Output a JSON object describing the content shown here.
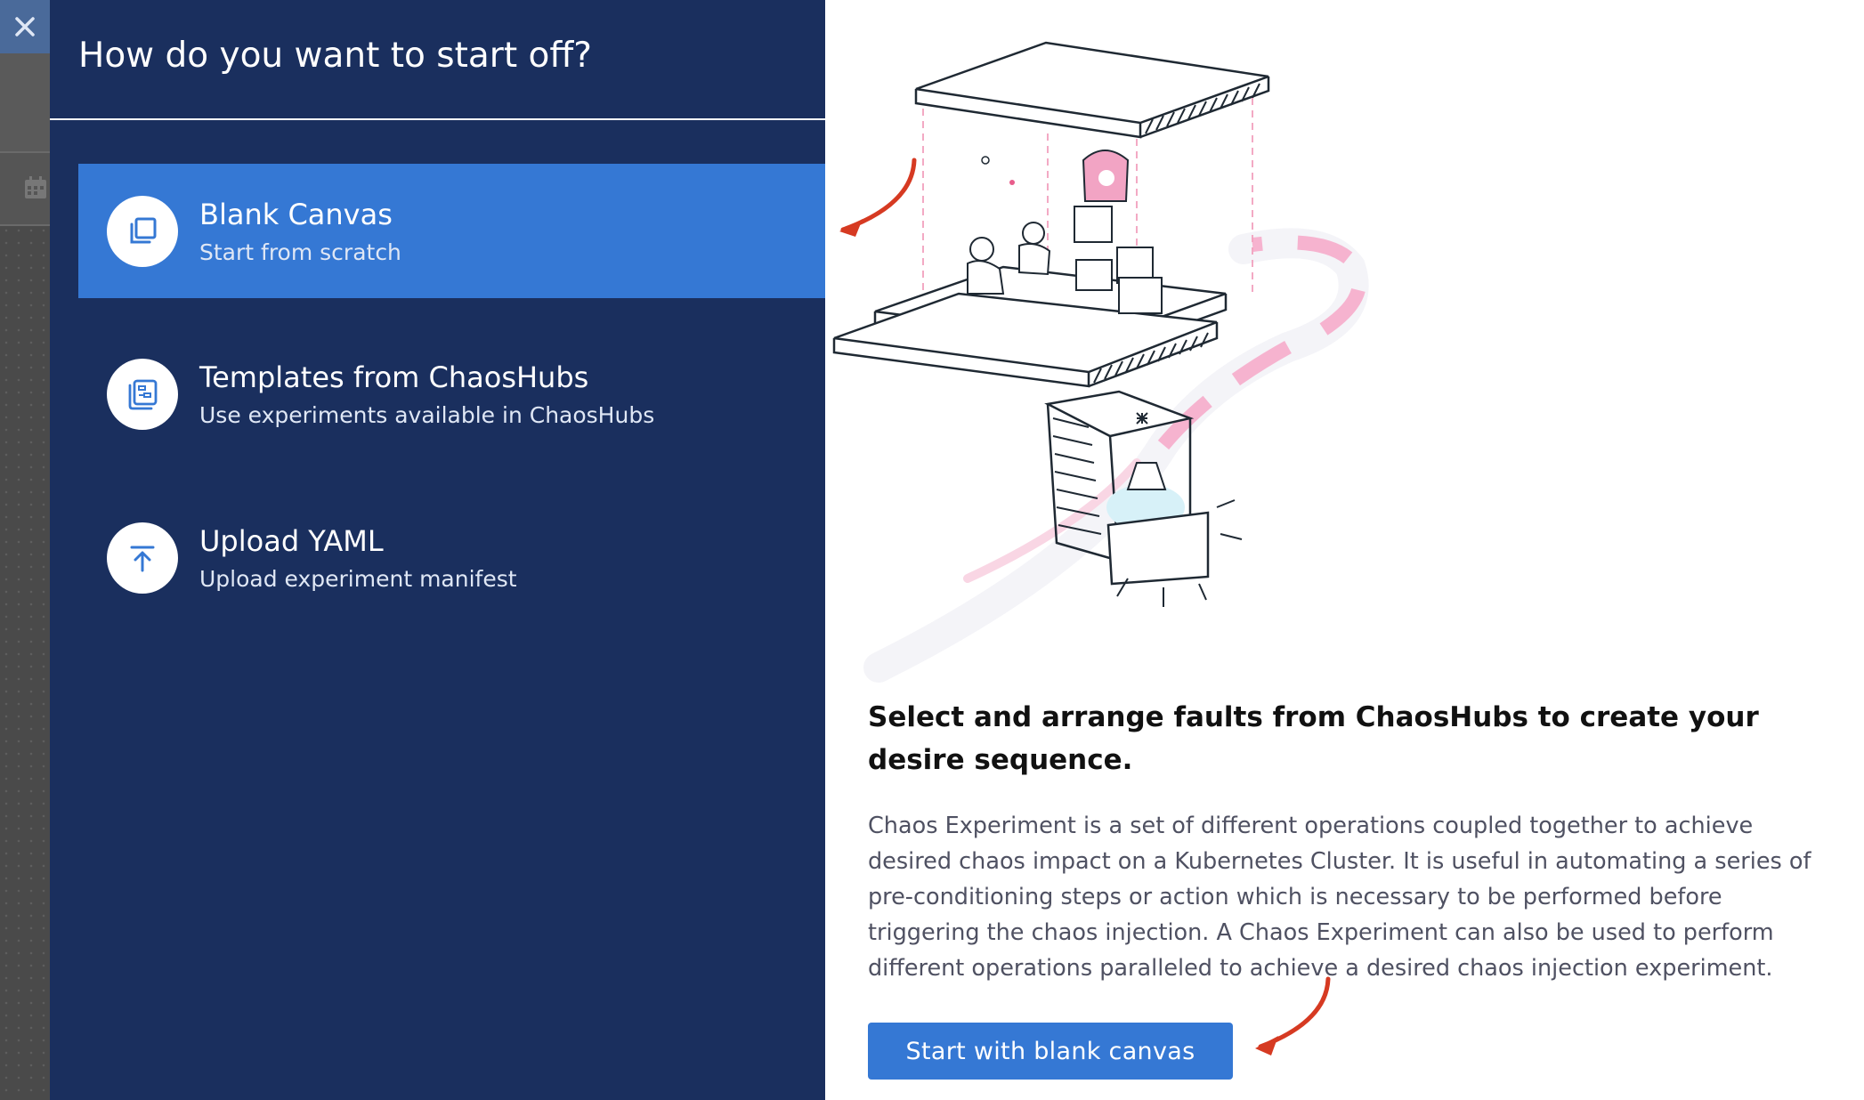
{
  "dialog": {
    "title": "How do you want to start off?",
    "options": [
      {
        "title": "Blank Canvas",
        "subtitle": "Start from scratch",
        "icon": "copy-icon",
        "selected": true
      },
      {
        "title": "Templates from ChaosHubs",
        "subtitle": "Use experiments available in ChaosHubs",
        "icon": "template-icon",
        "selected": false
      },
      {
        "title": "Upload YAML",
        "subtitle": "Upload experiment manifest",
        "icon": "upload-icon",
        "selected": false
      }
    ]
  },
  "detail": {
    "heading": "Select and arrange faults from ChaosHubs to create your desire sequence.",
    "description": "Chaos Experiment is a set of different operations coupled together to achieve desired chaos impact on a Kubernetes Cluster. It is useful in automating a series of pre-conditioning steps or action which is necessary to be performed before triggering the chaos injection. A Chaos Experiment can also be used to perform different operations paralleled to achieve a desired chaos injection experiment.",
    "button_label": "Start with blank canvas"
  },
  "colors": {
    "panel_bg": "#1a2f5e",
    "selected_bg": "#3578d4",
    "accent_arrow": "#d63a22",
    "button_bg": "#3578d4"
  }
}
